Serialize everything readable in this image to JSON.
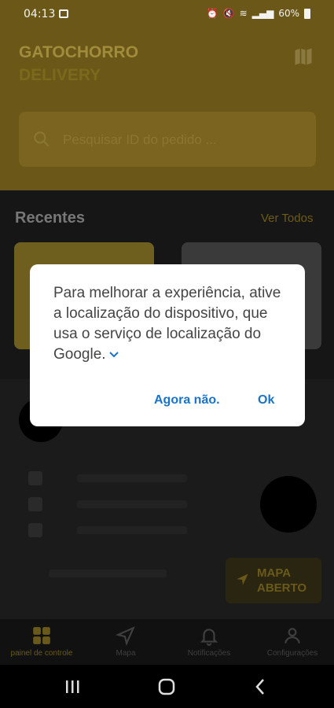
{
  "status": {
    "time": "04:13",
    "battery": "60%"
  },
  "header": {
    "brand_line1": "GATOCHORRO",
    "brand_line2": "DELIVERY"
  },
  "search": {
    "placeholder": "Pesquisar ID do pedido ..."
  },
  "recent": {
    "title": "Recentes",
    "view_all": "Ver Todos"
  },
  "map_button": {
    "line1": "MAPA",
    "line2": "ABERTO"
  },
  "bottom_nav": {
    "items": [
      {
        "label": "painel de controle",
        "icon": "dashboard-grid-icon",
        "active": true
      },
      {
        "label": "Mapa",
        "icon": "navigation-arrow-icon",
        "active": false
      },
      {
        "label": "Notificações",
        "icon": "bell-icon",
        "active": false
      },
      {
        "label": "Configurações",
        "icon": "person-icon",
        "active": false
      }
    ]
  },
  "dialog": {
    "message": "Para melhorar a experiência, ative a localização do dispositivo, que usa o serviço de localização do Google.",
    "buttons": {
      "later": "Agora não.",
      "ok": "Ok"
    }
  },
  "colors": {
    "header": "#6b5718",
    "accent": "#1a73c8",
    "dialog_bg": "#ffffff"
  }
}
